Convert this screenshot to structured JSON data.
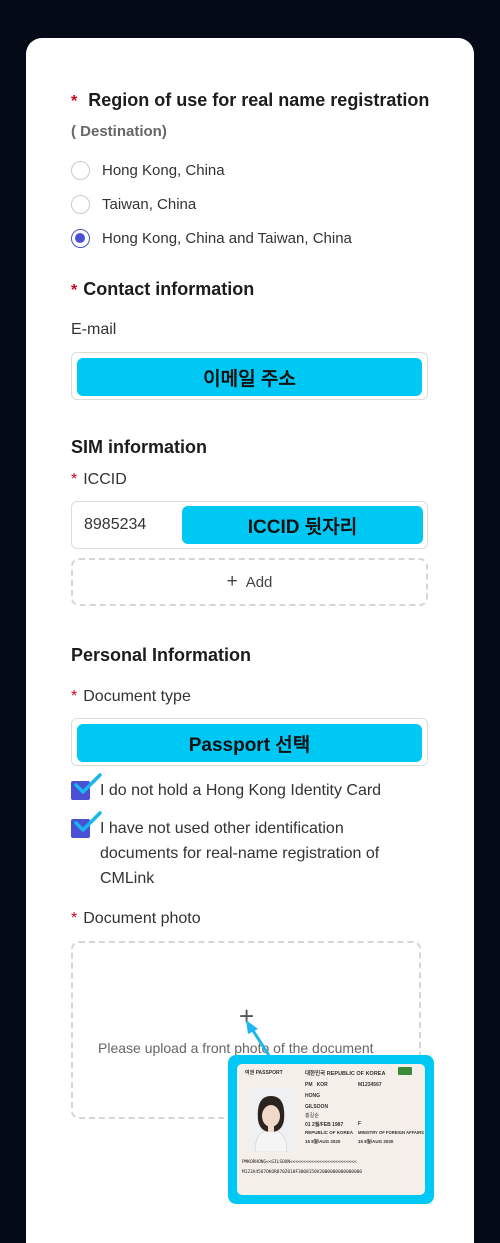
{
  "region": {
    "title": "Region of use for real name registration",
    "subtitle": "( Destination)",
    "options": [
      {
        "label": "Hong Kong, China",
        "selected": false
      },
      {
        "label": "Taiwan, China",
        "selected": false
      },
      {
        "label": "Hong Kong, China and Taiwan, China",
        "selected": true
      }
    ]
  },
  "contact": {
    "title": "Contact information",
    "email_label": "E-mail",
    "email_overlay": "이메일 주소"
  },
  "sim": {
    "title": "SIM information",
    "iccid_label": "ICCID",
    "iccid_prefix": "8985234",
    "iccid_overlay": "ICCID 뒷자리",
    "add_label": "Add"
  },
  "personal": {
    "title": "Personal Information",
    "doc_type_label": "Document type",
    "doc_type_overlay": "Passport 선택",
    "checks": [
      "I do not hold a Hong Kong Identity Card",
      "I have not used other identification documents for real-name registration of CMLink"
    ],
    "photo_label": "Document photo",
    "upload_hint": "Please upload a front photo of the document"
  },
  "passport_sample": {
    "type_label": "여권 PASSPORT",
    "country_label": "대한민국 REPUBLIC OF KOREA",
    "surname": "HONG",
    "given_name": "GILSOON",
    "korean_name": "홍길순",
    "passport_no": "M1234567",
    "type_code": "PM",
    "country_code": "KOR",
    "dob": "01 2월/FEB 1987",
    "sex": "F",
    "nationality": "REPUBLIC OF KOREA",
    "authority": "MINISTRY OF FOREIGN AFFAIRS",
    "issue_date": "15 8월/AUG 2020",
    "expiry_date": "15 8월/AUG 2030",
    "mrz1": "PMKORHONG<<GILSOON<<<<<<<<<<<<<<<<<<<<<<<<<",
    "mrz2": "M123A4567OKOR8702010F3008150V2000000000000000"
  },
  "colors": {
    "accent": "#4a4fd4",
    "highlight": "#00c8f5",
    "required": "#d0021b",
    "background": "#050b16"
  }
}
